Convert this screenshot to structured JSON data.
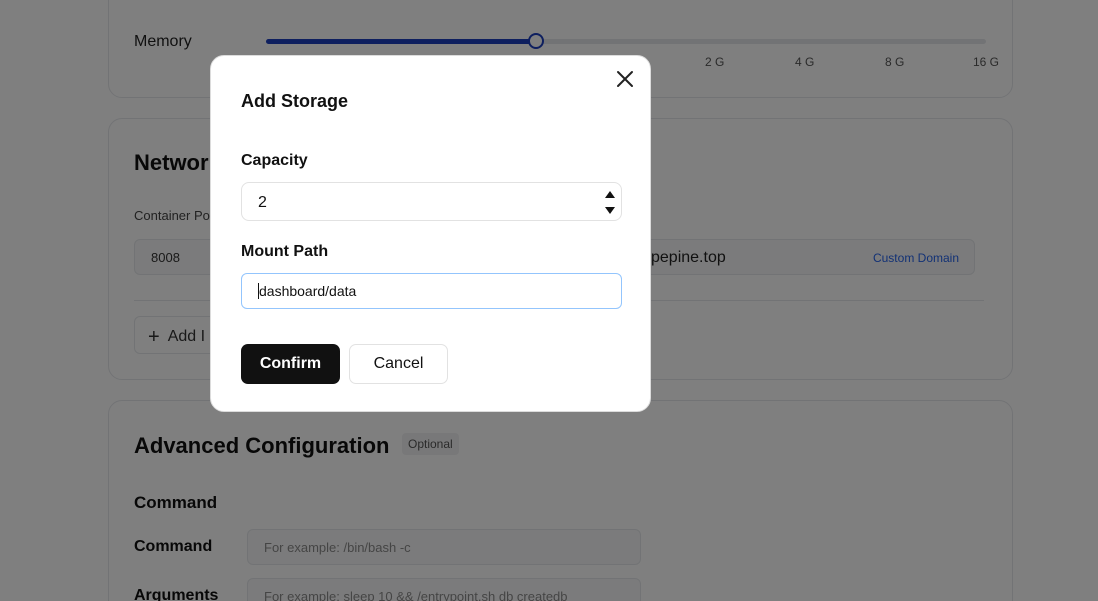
{
  "background": {
    "memory": {
      "label": "Memory",
      "value_fraction": 0.375,
      "ticks": [
        "2 G",
        "4 G",
        "8 G",
        "16 G"
      ]
    },
    "network": {
      "title": "Networ",
      "port_label": "Container Po",
      "port_value": "8008",
      "domain_value": "pepine.top",
      "custom_domain_link": "Custom Domain",
      "add_label": "Add I"
    },
    "advanced": {
      "title": "Advanced Configuration",
      "badge": "Optional",
      "command_heading": "Command",
      "command_label": "Command",
      "command_placeholder": "For example:  /bin/bash -c",
      "arguments_label": "Arguments",
      "arguments_placeholder": "For example:  sleep 10 && /entrypoint.sh db createdb"
    }
  },
  "modal": {
    "title": "Add Storage",
    "capacity_label": "Capacity",
    "capacity_value": "2",
    "mount_path_label": "Mount Path",
    "mount_path_value": "dashboard/data",
    "confirm_label": "Confirm",
    "cancel_label": "Cancel"
  },
  "colors": {
    "accent": "#1d3fbf",
    "link": "#2563eb",
    "primary_button": "#111111",
    "focus_border": "#93c5fd"
  },
  "icons": [
    "close-icon",
    "plus-icon",
    "spin-up-icon",
    "spin-down-icon"
  ]
}
